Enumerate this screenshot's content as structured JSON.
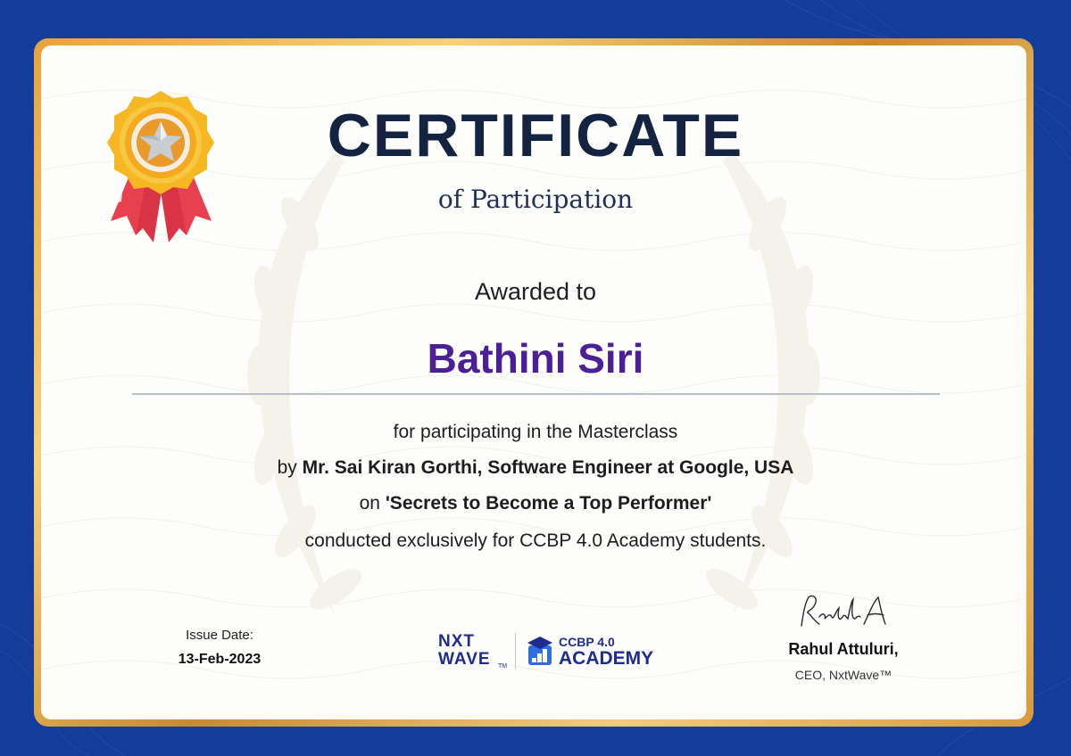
{
  "certificate": {
    "title": "CERTIFICATE",
    "subtitle": "of Participation",
    "awarded_label": "Awarded to",
    "recipient": "Bathini Siri",
    "line1": "for participating in the Masterclass",
    "line2_prefix": "by ",
    "line2_bold": "Mr. Sai Kiran Gorthi, Software Engineer at Google, USA",
    "line3_prefix": "on ",
    "line3_bold": "'Secrets to Become a Top Performer'",
    "line4": "conducted exclusively for CCBP 4.0 Academy students."
  },
  "issue": {
    "label": "Issue Date:",
    "date": "13-Feb-2023"
  },
  "logos": {
    "nxt": "NXT",
    "wave": "WAVE",
    "tm": "TM",
    "ccbp": "CCBP 4.0",
    "academy": "ACADEMY"
  },
  "signer": {
    "signature": "Rahul A",
    "name": "Rahul Attuluri,",
    "title": "CEO, NxtWave™"
  },
  "icons": {
    "medal": "medal-star-icon",
    "cap": "graduation-cap-icon",
    "wreath": "laurel-wreath-icon"
  },
  "colors": {
    "background": "#143c9a",
    "border_gold": "#e8a33a",
    "title": "#14233f",
    "recipient": "#4b1f96",
    "brand_blue": "#1e2b8f"
  }
}
